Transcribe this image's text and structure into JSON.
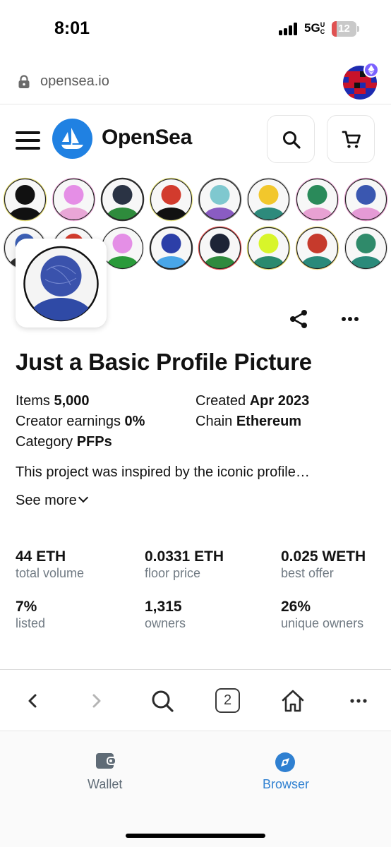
{
  "status_bar": {
    "time": "8:01",
    "network": "5G",
    "network_suffix": "UC",
    "battery_level": "12"
  },
  "url_bar": {
    "url": "opensea.io"
  },
  "header": {
    "brand": "OpenSea"
  },
  "banner": {
    "row1": [
      {
        "head": "#111111",
        "body": "#111111",
        "ring": "#e8e07a"
      },
      {
        "head": "#e58ee6",
        "body": "#e9a6d7",
        "ring": "#f2b8e2"
      },
      {
        "head": "#2a3344",
        "body": "#2e8b3c",
        "ring": "#333333"
      },
      {
        "head": "#d23b2d",
        "body": "#111111",
        "ring": "#ecea88"
      },
      {
        "head": "#7fc8cf",
        "body": "#8a5cc2",
        "ring": "#777777"
      },
      {
        "head": "#f2c72c",
        "body": "#2d8a7c",
        "ring": "#cccccc"
      },
      {
        "head": "#2a8a5a",
        "body": "#e8a1d3",
        "ring": "#f3b8e0"
      },
      {
        "head": "#3a57b0",
        "body": "#e59ad6",
        "ring": "#e5a0cf"
      }
    ],
    "row2": [
      {
        "head": "#3c5fb4",
        "body": "#2d2d2d",
        "ring": "#cccccc"
      },
      {
        "head": "#d23b2d",
        "body": "#f0f0f0",
        "ring": "#dddddd"
      },
      {
        "head": "#e48fe6",
        "body": "#2a9a3a",
        "ring": "#eeeeee"
      },
      {
        "head": "#2c3fa8",
        "body": "#49a6e8",
        "ring": "#333333"
      },
      {
        "head": "#1d2436",
        "body": "#2f8a3e",
        "ring": "#e05050"
      },
      {
        "head": "#d8f52a",
        "body": "#2a8a6e",
        "ring": "#dddd66"
      },
      {
        "head": "#c63a2c",
        "body": "#2a8a7a",
        "ring": "#eedd88"
      },
      {
        "head": "#2f8a6a",
        "body": "#2a8a7a",
        "ring": "#dddddd"
      }
    ]
  },
  "collection": {
    "title": "Just a Basic Profile Picture",
    "avatar": {
      "head": "#3a52ac",
      "body": "#2f4aa6"
    },
    "items_label": "Items",
    "items_value": "5,000",
    "created_label": "Created",
    "created_value": "Apr 2023",
    "earnings_label": "Creator earnings",
    "earnings_value": "0%",
    "chain_label": "Chain",
    "chain_value": "Ethereum",
    "category_label": "Category",
    "category_value": "PFPs",
    "description": "This project was inspired by the iconic profile…",
    "see_more": "See more"
  },
  "stats": [
    {
      "value": "44 ETH",
      "label": "total volume"
    },
    {
      "value": "0.0331 ETH",
      "label": "floor price"
    },
    {
      "value": "0.025 WETH",
      "label": "best offer"
    },
    {
      "value": "7%",
      "label": "listed"
    },
    {
      "value": "1,315",
      "label": "owners"
    },
    {
      "value": "26%",
      "label": "unique owners"
    }
  ],
  "browser_toolbar": {
    "tab_count": "2"
  },
  "bottom_nav": {
    "wallet_label": "Wallet",
    "browser_label": "Browser",
    "active": "Browser",
    "active_color": "#2f80d1",
    "inactive_color": "#5f6b76"
  }
}
